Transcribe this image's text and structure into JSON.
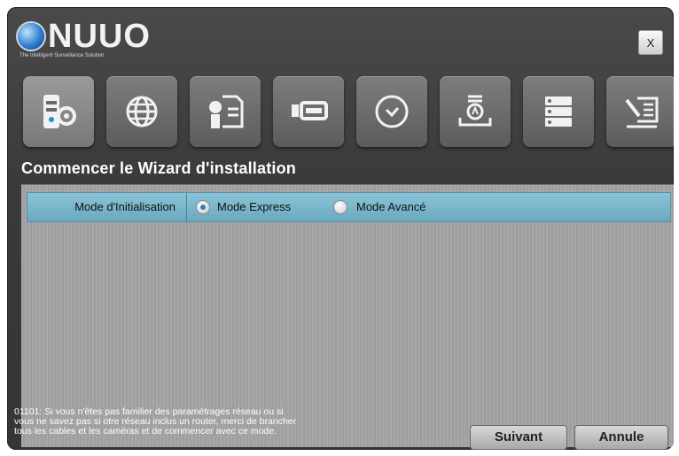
{
  "brand": {
    "name": "NUUO",
    "tagline": "The Intelligent Surveillance Solution"
  },
  "window": {
    "close_label": "X"
  },
  "toolbar": {
    "tools": [
      {
        "icon": "server-settings-icon"
      },
      {
        "icon": "globe-network-icon"
      },
      {
        "icon": "license-document-icon"
      },
      {
        "icon": "storage-device-icon"
      },
      {
        "icon": "clock-icon"
      },
      {
        "icon": "install-archive-icon"
      },
      {
        "icon": "storage-list-icon"
      },
      {
        "icon": "tools-checklist-icon"
      }
    ]
  },
  "wizard": {
    "title": "Commencer le Wizard d'installation",
    "mode_label": "Mode d'Initialisation",
    "option_express": "Mode Express",
    "option_advanced": "Mode Avancé",
    "selected": "Mode Express"
  },
  "footer": {
    "hint_line1": "01101: Si vous n'êtes pas familier des paramétrages réseau ou si",
    "hint_line2": "vous ne savez pas si otre réseau inclus un router, merci de brancher",
    "hint_line3": "tous les cables et les caméras et de commencer avec ce mode.",
    "next_label": "Suivant",
    "cancel_label": "Annule"
  },
  "colors": {
    "mode_row": "#7bb7cc",
    "radio_selected": "#2a7fb8",
    "background": "#3d3d3d"
  }
}
